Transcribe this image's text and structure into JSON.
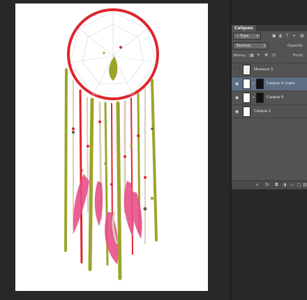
{
  "layers_panel": {
    "tab_title": "Calques",
    "filter": {
      "value": "Type",
      "icons": [
        "image-filter-icon",
        "adjustment-filter-icon",
        "type-filter-icon",
        "shape-filter-icon",
        "smart-object-filter-icon"
      ]
    },
    "blend_mode": "Normal",
    "opacity_label": "Opacité :",
    "lock_label": "Verrou. :",
    "fill_label": "Fond :",
    "layers": [
      {
        "name": "Niveaux 1",
        "visible": false,
        "selected": false,
        "kind": "adjustment"
      },
      {
        "name": "Calque 0 copie",
        "visible": true,
        "selected": true,
        "kind": "pixel-with-mask"
      },
      {
        "name": "Calque 0",
        "visible": true,
        "selected": false,
        "kind": "pixel-with-mask"
      },
      {
        "name": "Calque 1",
        "visible": true,
        "selected": false,
        "kind": "white-fill"
      }
    ],
    "footer_icons": [
      "link-layers-icon",
      "fx-icon",
      "add-mask-icon",
      "adjustment-layer-icon",
      "group-icon",
      "new-layer-icon",
      "trash-icon"
    ]
  },
  "canvas": {
    "subject": "dreamcatcher",
    "colors": {
      "hoop": "#e0242d",
      "olive": "#9aa52a",
      "pink": "#e8508a",
      "beige": "#d8cfbd"
    }
  }
}
